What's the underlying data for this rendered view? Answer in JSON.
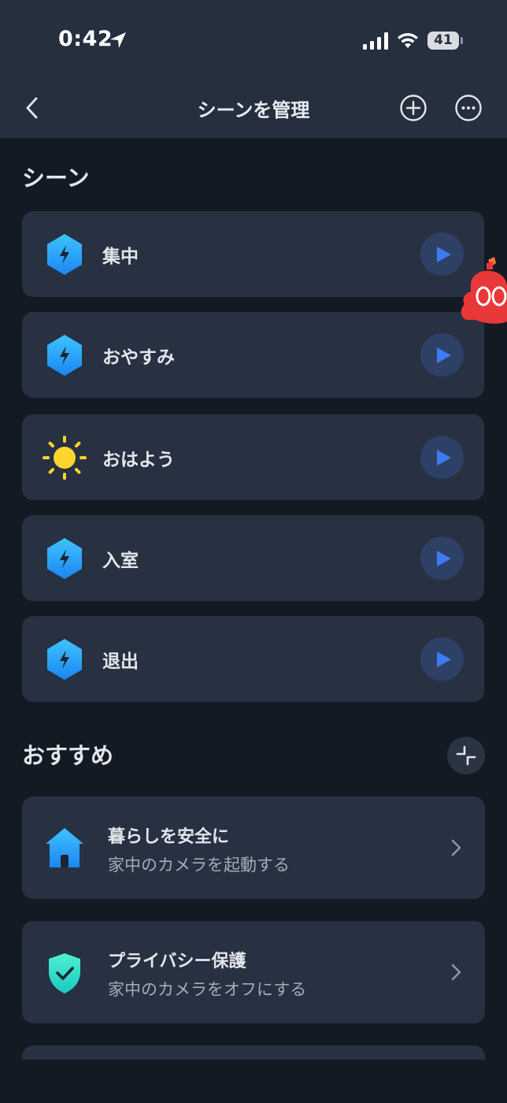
{
  "status_bar": {
    "time": "0:42",
    "battery": "41"
  },
  "nav": {
    "title": "シーンを管理"
  },
  "scenes": {
    "title": "シーン",
    "items": [
      {
        "label": "集中",
        "icon": "lightning-hex-icon"
      },
      {
        "label": "おやすみ",
        "icon": "lightning-hex-icon"
      },
      {
        "label": "おはよう",
        "icon": "sun-icon"
      },
      {
        "label": "入室",
        "icon": "lightning-hex-icon"
      },
      {
        "label": "退出",
        "icon": "lightning-hex-icon"
      }
    ]
  },
  "recommended": {
    "title": "おすすめ",
    "items": [
      {
        "title": "暮らしを安全に",
        "subtitle": "家中のカメラを起動する",
        "icon": "house-icon"
      },
      {
        "title": "プライバシー保護",
        "subtitle": "家中のカメラをオフにする",
        "icon": "shield-check-icon"
      }
    ]
  },
  "colors": {
    "background": "#131a24",
    "header": "#252f3e",
    "card": "#273141",
    "accent_blue": "#3d7bf0",
    "sun_yellow": "#fcd52e",
    "mascot_red": "#e8383a"
  }
}
